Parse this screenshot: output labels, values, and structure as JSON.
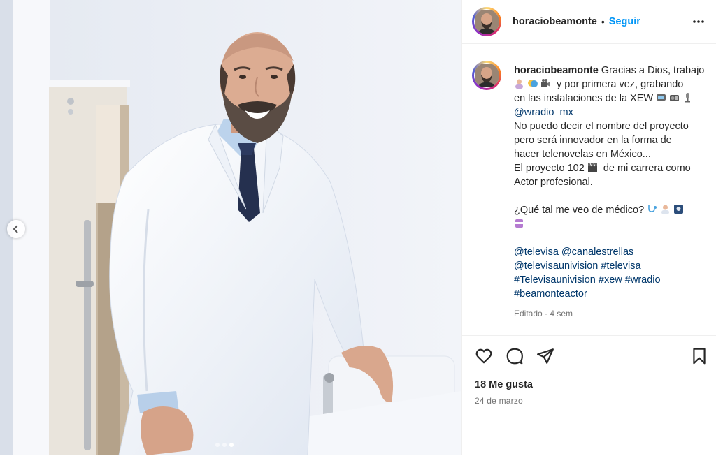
{
  "post": {
    "username": "horaciobeamonte",
    "separator": "•",
    "follow_label": "Seguir"
  },
  "caption": {
    "username": "horaciobeamonte",
    "line1": "Gracias a Dios, trabajo",
    "line2": "y por primera vez, grabando",
    "line3": "en las instalaciones de la XEW",
    "mention1": "@wradio_mx",
    "line5": "No puedo decir el nombre del proyecto",
    "line6": "pero será innovador en la forma de",
    "line7": "hacer telenovelas en México...",
    "line8a": "El proyecto 102",
    "line8b": "de mi carrera como",
    "line9": "Actor profesional.",
    "line10": "¿Qué tal me veo de médico?",
    "tags1a": "@televisa",
    "tags1b": "@canalestrellas",
    "tags2a": "@televisaunivision",
    "tags2b": "#televisa",
    "tags3a": "#Televisaunivision",
    "tags3b": "#xew",
    "tags3c": "#wradio",
    "tags4": "#beamonteactor",
    "edited": "Editado · 4 sem"
  },
  "footer": {
    "likes": "18 Me gusta",
    "date": "24 de marzo"
  },
  "icons": {
    "like": "heart-icon",
    "comment": "comment-icon",
    "share": "share-icon",
    "save": "bookmark-icon",
    "more": "more-icon",
    "prev": "chevron-left-icon"
  },
  "colors": {
    "link": "#00376b",
    "follow": "#0095f6",
    "text": "#262626",
    "muted": "#737373"
  }
}
